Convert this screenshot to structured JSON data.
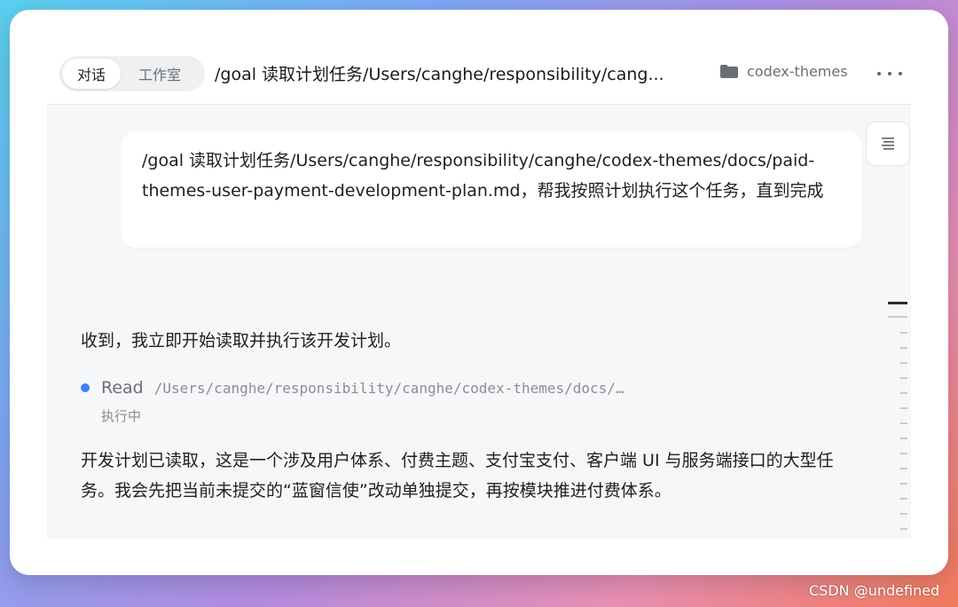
{
  "header": {
    "tabs": [
      {
        "label": "对话",
        "active": true
      },
      {
        "label": "工作室",
        "active": false
      }
    ],
    "title": "/goal 读取计划任务/Users/canghe/responsibility/cang...",
    "project_name": "codex-themes"
  },
  "conversation": {
    "user_message": "/goal 读取计划任务/Users/canghe/responsibility/canghe/codex-themes/docs/paid-themes-user-payment-development-plan.md，帮我按照计划执行这个任务，直到完成",
    "assistant_intro": "收到，我立即开始读取并执行该开发计划。",
    "tool_call": {
      "action": "Read",
      "path": "/Users/canghe/responsibility/canghe/codex-themes/docs/…",
      "status": "执行中",
      "status_color": "#3b82f6"
    },
    "assistant_followup": "开发计划已读取，这是一个涉及用户体系、付费主题、支付宝支付、客户端 UI 与服务端接口的大型任务。我会先把当前未提交的“蓝窗信使”改动单独提交，再按模块推进付费体系。"
  },
  "watermark": "CSDN @undefined"
}
